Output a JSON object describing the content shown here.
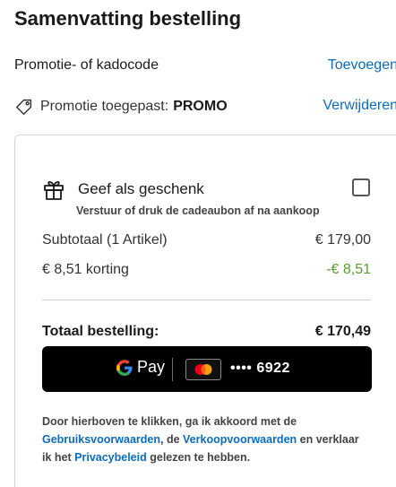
{
  "header": {
    "title": "Samenvatting bestelling"
  },
  "promo": {
    "label": "Promotie- of kadocode",
    "add_link": "Toevoegen",
    "applied_prefix": "Promotie toegepast:",
    "applied_code": "PROMO",
    "remove_link": "Verwijderen",
    "icon": "tag-icon"
  },
  "gift": {
    "icon": "gift-icon",
    "label": "Geef als geschenk",
    "checked": false,
    "sublabel": "Verstuur of druk de cadeaubon af na aankoop"
  },
  "summary": {
    "subtotal_label": "Subtotaal (1 Artikel)",
    "subtotal_value": "€ 179,00",
    "discount_label": "€ 8,51 korting",
    "discount_value": "-€ 8,51",
    "total_label": "Totaal bestelling:",
    "total_value": "€ 170,49"
  },
  "payment": {
    "pay_text": "Pay",
    "card_masked": "•••• 6922",
    "card_icon": "mastercard-icon",
    "colors": {
      "button_bg": "#000000",
      "mc_red": "#eb001b",
      "mc_orange": "#f79e1b"
    }
  },
  "terms": {
    "part1": "Door hierboven te klikken, ga ik akkoord met de",
    "link1": "Gebruiksvoorwaarden",
    "part2": ", de",
    "link2": "Verkoopvoorwaarden",
    "part3": "en verklaar ik het",
    "link3": "Privacybeleid",
    "part4": "gelezen te hebben."
  },
  "colors": {
    "link": "#0a6bbf",
    "discount": "#5b9a2e",
    "border": "#d4d4d4"
  }
}
